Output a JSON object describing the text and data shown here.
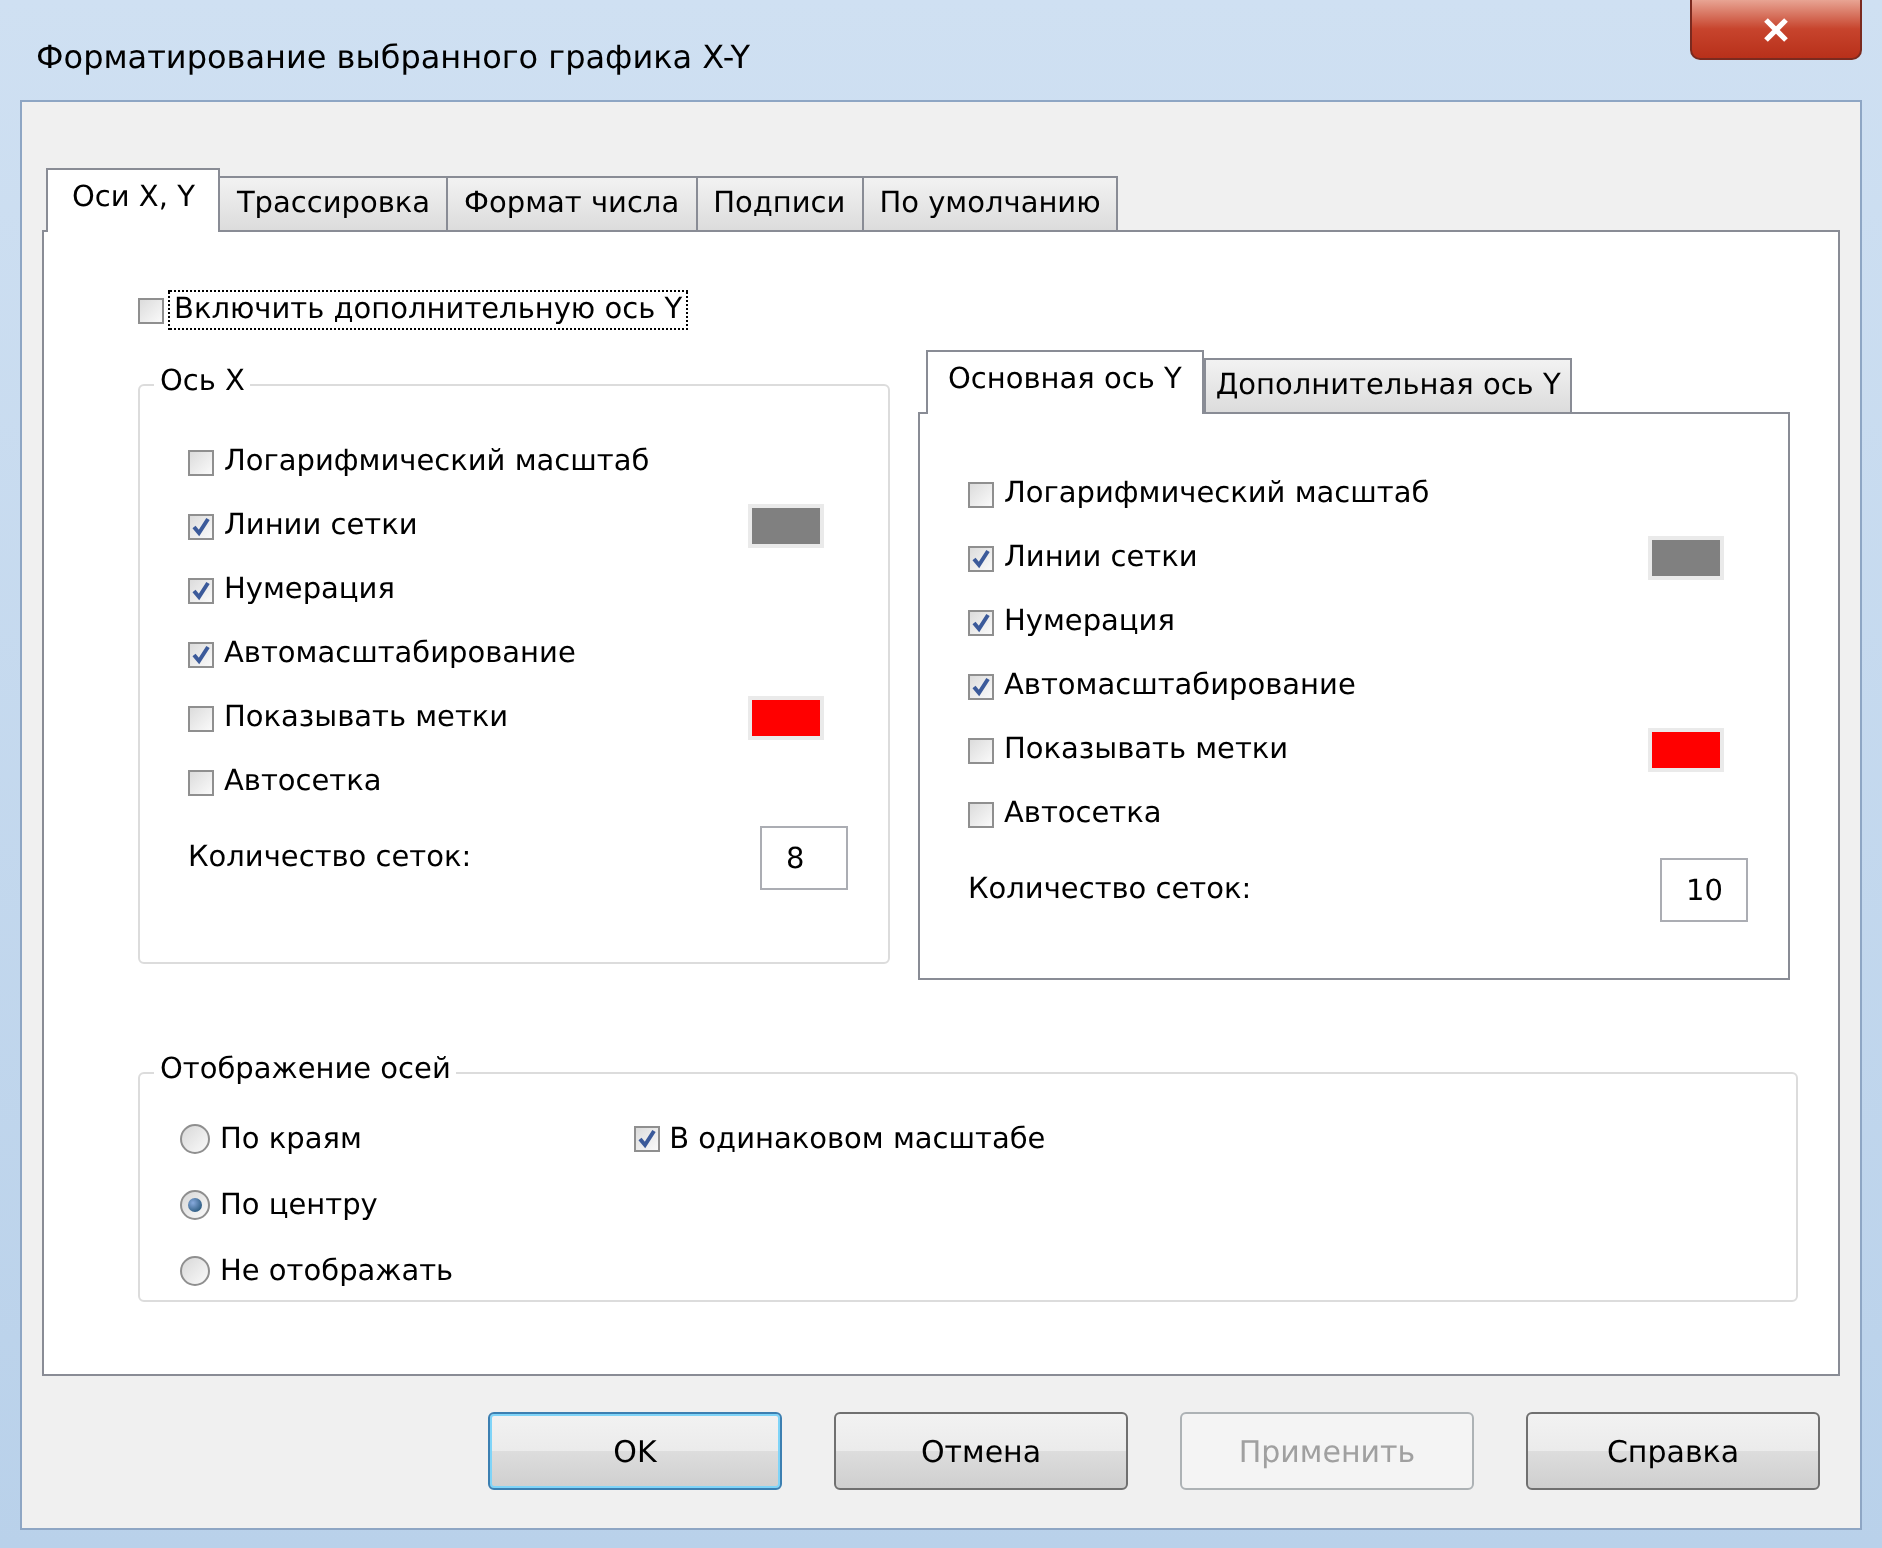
{
  "window": {
    "title": "Форматирование выбранного графика X-Y"
  },
  "tabs": [
    {
      "label": "Оси X, Y",
      "selected": true
    },
    {
      "label": "Трассировка",
      "selected": false
    },
    {
      "label": "Формат числа",
      "selected": false
    },
    {
      "label": "Подписи",
      "selected": false
    },
    {
      "label": "По умолчанию",
      "selected": false
    }
  ],
  "secondary_y": {
    "label": "Включить дополнительную ось Y",
    "checked": false
  },
  "x_axis": {
    "title": "Ось X",
    "options": [
      {
        "label": "Логарифмический масштаб",
        "checked": false
      },
      {
        "label": "Линии сетки",
        "checked": true,
        "color": "#808080"
      },
      {
        "label": "Нумерация",
        "checked": true
      },
      {
        "label": "Автомасштабирование",
        "checked": true
      },
      {
        "label": "Показывать метки",
        "checked": false,
        "color": "#ff0000"
      },
      {
        "label": "Автосетка",
        "checked": false
      }
    ],
    "grid_count": {
      "label": "Количество сеток:",
      "value": "8"
    }
  },
  "y_axis": {
    "tabs": [
      {
        "label": "Основная ось Y",
        "selected": true
      },
      {
        "label": "Дополнительная ось Y",
        "selected": false
      }
    ],
    "options": [
      {
        "label": "Логарифмический масштаб",
        "checked": false
      },
      {
        "label": "Линии сетки",
        "checked": true,
        "color": "#808080"
      },
      {
        "label": "Нумерация",
        "checked": true
      },
      {
        "label": "Автомасштабирование",
        "checked": true
      },
      {
        "label": "Показывать метки",
        "checked": false,
        "color": "#ff0000"
      },
      {
        "label": "Автосетка",
        "checked": false
      }
    ],
    "grid_count": {
      "label": "Количество сеток:",
      "value": "10"
    }
  },
  "axes_display": {
    "title": "Отображение осей",
    "radios": [
      {
        "label": "По краям",
        "selected": false
      },
      {
        "label": "По центру",
        "selected": true
      },
      {
        "label": "Не отображать",
        "selected": false
      }
    ],
    "same_scale": {
      "label": "В одинаковом масштабе",
      "checked": true
    }
  },
  "buttons": [
    {
      "label": "OK",
      "kind": "default",
      "disabled": false
    },
    {
      "label": "Отмена",
      "kind": "normal",
      "disabled": false
    },
    {
      "label": "Применить",
      "kind": "normal",
      "disabled": true
    },
    {
      "label": "Справка",
      "kind": "normal",
      "disabled": false
    }
  ]
}
